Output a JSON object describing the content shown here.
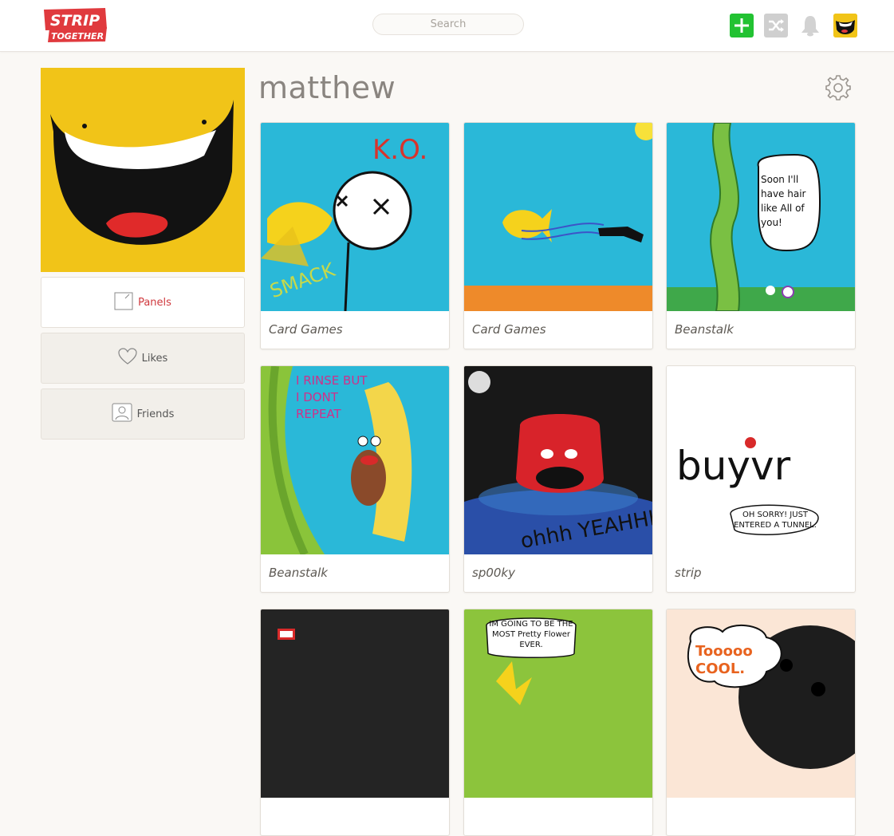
{
  "brand": {
    "logo_line1": "STRIP",
    "logo_line2": "TOGETHER",
    "accent": "#e03a3e"
  },
  "header": {
    "search_placeholder": "Search",
    "new_strip_icon": "plus-icon",
    "random_icon": "shuffle-icon",
    "notifications_icon": "bell-icon"
  },
  "profile": {
    "username": "matthew"
  },
  "sidebar": {
    "tabs": [
      {
        "label": "Panels",
        "icon": "panel-edit-icon",
        "active": true
      },
      {
        "label": "Likes",
        "icon": "heart-icon",
        "active": false
      },
      {
        "label": "Friends",
        "icon": "person-icon",
        "active": false
      }
    ]
  },
  "cards": [
    {
      "title": "Card Games",
      "art_text": "K.O.",
      "art_text2": "SMACK"
    },
    {
      "title": "Card Games"
    },
    {
      "title": "Beanstalk",
      "art_text": "Soon I'll have hair like All of you!"
    },
    {
      "title": "Beanstalk",
      "art_text": "I RINSE BUT I DONT REPEAT"
    },
    {
      "title": "sp00ky",
      "art_text": "ohhh YEAHHH"
    },
    {
      "title": "strip",
      "art_text": "buyvr",
      "art_text2": "OH SORRY! JUST ENTERED A TUNNEL."
    },
    {
      "title": ""
    },
    {
      "title": "",
      "art_text": "IM GOING TO BE THE MOST Pretty Flower EVER."
    },
    {
      "title": "",
      "art_text": "Tooooo COOL."
    }
  ]
}
